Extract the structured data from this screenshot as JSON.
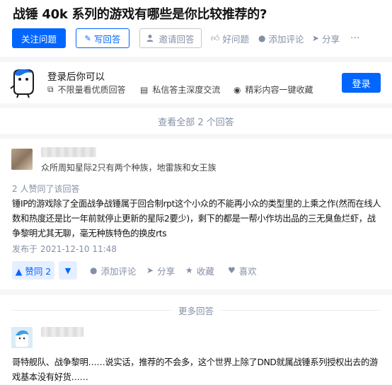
{
  "question": {
    "title": "战锤 40k 系列的游戏有哪些是你比较推荐的?",
    "follow_label": "关注问题",
    "write_label": "写回答",
    "invite_label": "邀请回答",
    "good_label": "好问题",
    "comment_label": "添加评论",
    "share_label": "分享",
    "more_label": "···"
  },
  "login": {
    "title": "登录后你可以",
    "features": [
      "不限量看优质回答",
      "私信答主深度交流",
      "精彩内容一键收藏"
    ],
    "button": "登录"
  },
  "view_all": "查看全部 2 个回答",
  "answer": {
    "author_bio": "众所周知星际2只有两个种族，地雷族和女王族",
    "upvote_info": "2 人赞同了该回答",
    "content": "锤IP的游戏除了全面战争战锤属于回合制rpt这个小众的不能再小众的类型里的上乘之作(然而在线人数和热度还是比一年前就停止更新的星际2要少)，剩下的都是一帮小作坊出品的三无臭鱼烂虾，战争黎明尤其无聊，毫无种族特色的换皮rts",
    "date": "发布于 2021-12-10 11:48",
    "vote_up": "▲ 赞同 2",
    "vote_down": "▼",
    "comment": "添加评论",
    "share": "分享",
    "favorite": "收藏",
    "like": "喜欢"
  },
  "more_answers": {
    "heading": "更多回答",
    "content": "哥特舰队、战争黎明……说实话，推荐的不会多，这个世界上除了DND就属战锤系列授权出去的游戏基本没有好货……"
  },
  "colors": {
    "brand": "#0066ff",
    "muted": "#8590a6",
    "vote_bg": "#e5efff"
  }
}
